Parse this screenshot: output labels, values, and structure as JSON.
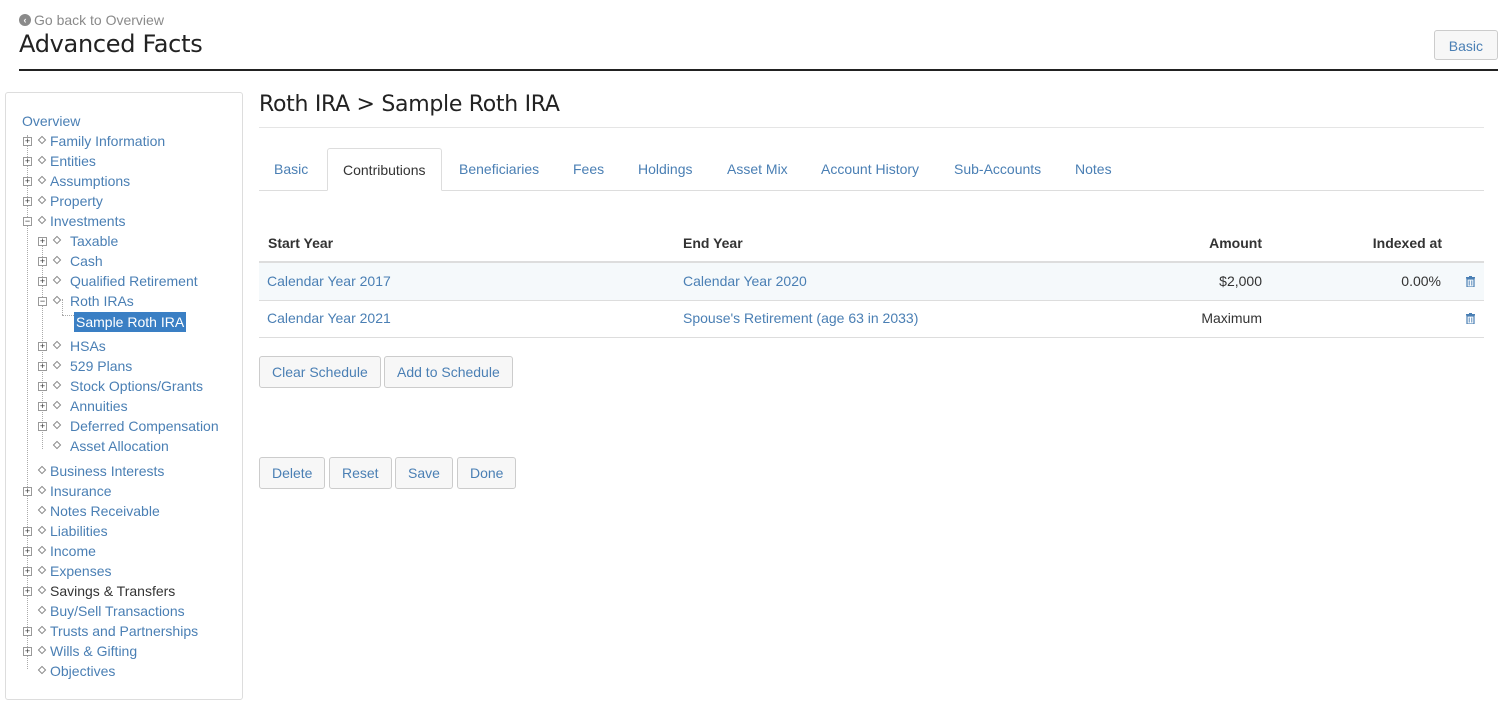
{
  "header": {
    "back_label": "Go back to Overview",
    "title": "Advanced Facts",
    "mode_button": "Basic"
  },
  "sidebar": {
    "overview": "Overview",
    "items": [
      {
        "label": "Family Information"
      },
      {
        "label": "Entities"
      },
      {
        "label": "Assumptions"
      },
      {
        "label": "Property"
      },
      {
        "label": "Investments"
      },
      {
        "label": "Taxable"
      },
      {
        "label": "Cash"
      },
      {
        "label": "Qualified Retirement"
      },
      {
        "label": "Roth IRAs"
      },
      {
        "label": "Sample Roth IRA"
      },
      {
        "label": "HSAs"
      },
      {
        "label": "529 Plans"
      },
      {
        "label": "Stock Options/Grants"
      },
      {
        "label": "Annuities"
      },
      {
        "label": "Deferred Compensation"
      },
      {
        "label": "Asset Allocation"
      },
      {
        "label": "Business Interests"
      },
      {
        "label": "Insurance"
      },
      {
        "label": "Notes Receivable"
      },
      {
        "label": "Liabilities"
      },
      {
        "label": "Income"
      },
      {
        "label": "Expenses"
      },
      {
        "label": "Savings & Transfers"
      },
      {
        "label": "Buy/Sell Transactions"
      },
      {
        "label": "Trusts and Partnerships"
      },
      {
        "label": "Wills & Gifting"
      },
      {
        "label": "Objectives"
      }
    ]
  },
  "main": {
    "title": "Roth IRA > Sample Roth IRA",
    "tabs": [
      {
        "label": "Basic"
      },
      {
        "label": "Contributions"
      },
      {
        "label": "Beneficiaries"
      },
      {
        "label": "Fees"
      },
      {
        "label": "Holdings"
      },
      {
        "label": "Asset Mix"
      },
      {
        "label": "Account History"
      },
      {
        "label": "Sub-Accounts"
      },
      {
        "label": "Notes"
      }
    ],
    "active_tab": "Contributions",
    "table": {
      "headers": [
        "Start Year",
        "End Year",
        "Amount",
        "Indexed at"
      ],
      "rows": [
        {
          "start": "Calendar Year 2017",
          "end": "Calendar Year 2020",
          "amount": "$2,000",
          "indexed": "0.00%"
        },
        {
          "start": "Calendar Year 2021",
          "end": "Spouse's Retirement (age 63 in 2033)",
          "amount": "Maximum",
          "indexed": ""
        }
      ]
    },
    "schedule_buttons": {
      "clear": "Clear Schedule",
      "add": "Add to Schedule"
    },
    "form_buttons": {
      "delete": "Delete",
      "reset": "Reset",
      "save": "Save",
      "done": "Done"
    }
  },
  "colors": {
    "link": "#4a7fb4",
    "selected_bg": "#3a7fc4"
  }
}
